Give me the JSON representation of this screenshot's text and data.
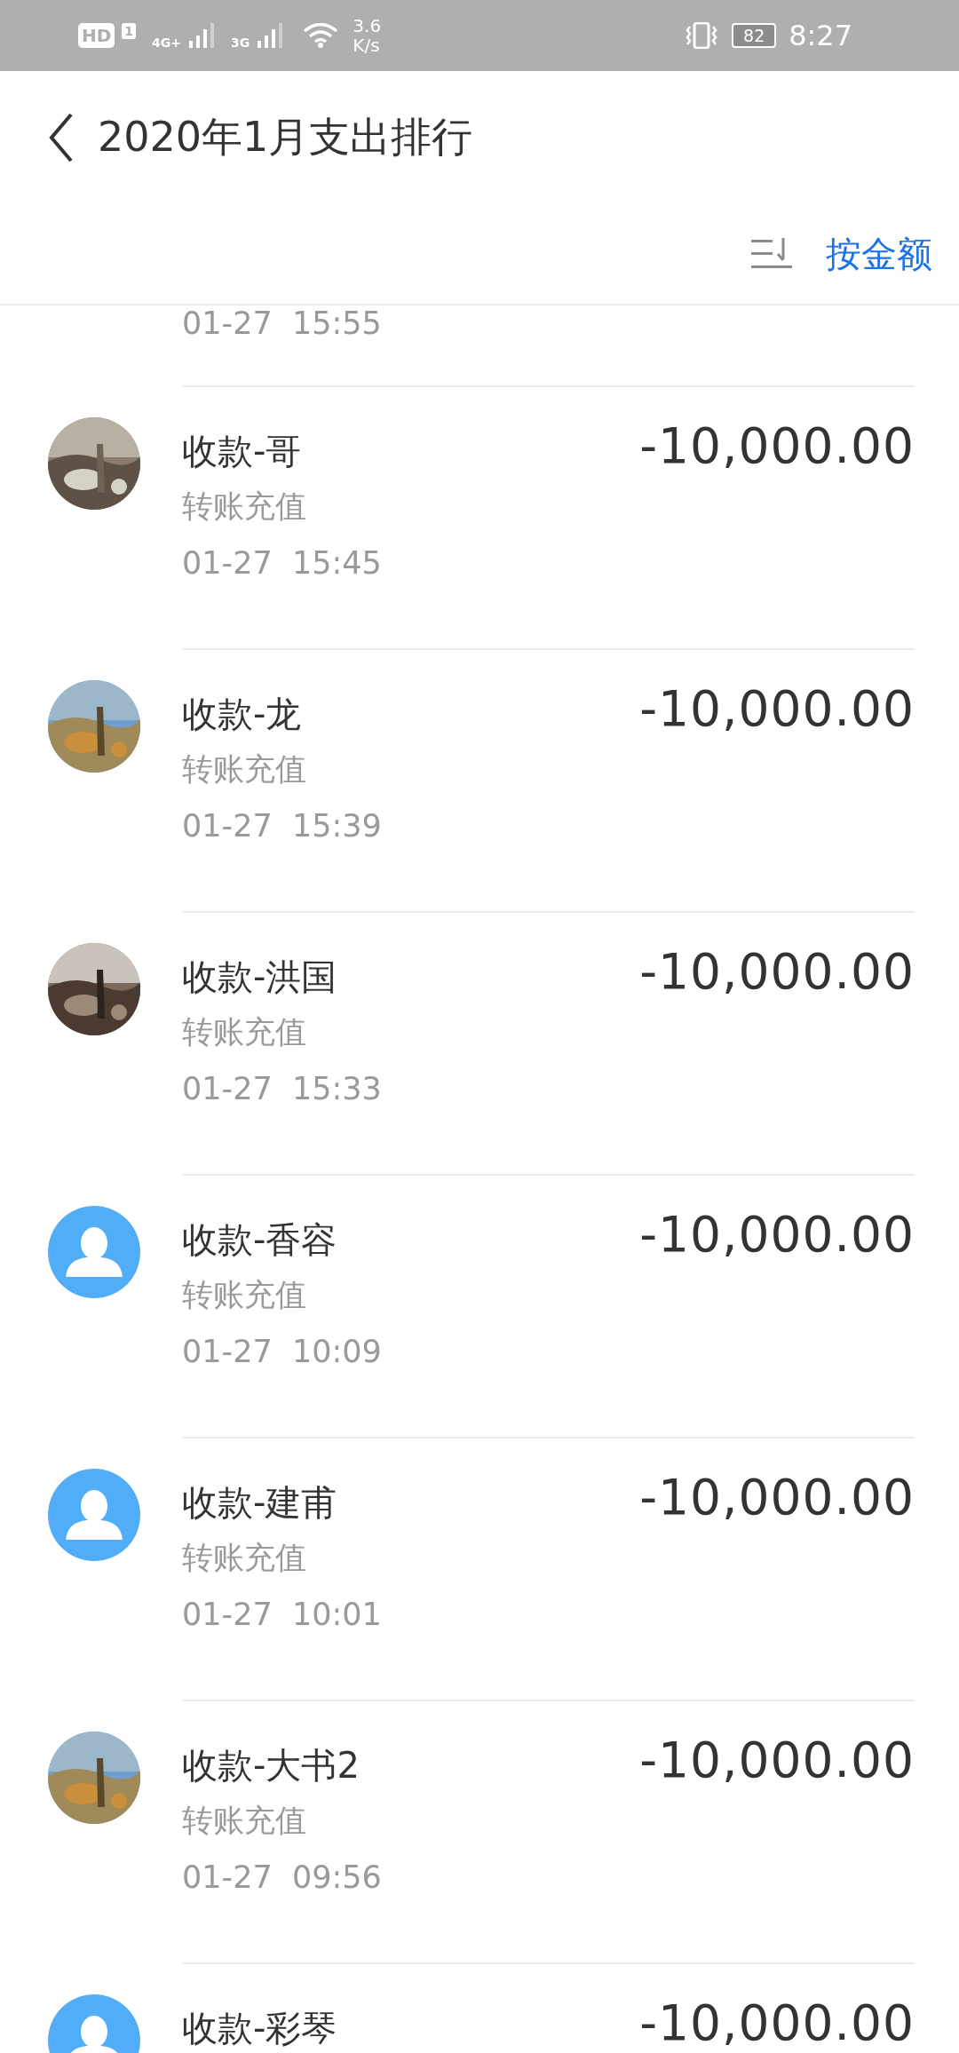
{
  "status_bar": {
    "hd": "HD",
    "sim": "1",
    "network_1": "4G+",
    "network_2": "3G",
    "speed_value": "3.6",
    "speed_unit": "K/s",
    "battery": "82",
    "time": "8:27"
  },
  "header": {
    "title": "2020年1月支出排行"
  },
  "sort": {
    "label": "按金额"
  },
  "partial_row": {
    "time": "01-27  15:55"
  },
  "rows": [
    {
      "kind": "picture",
      "name": "收款-哥",
      "category": "转账充值",
      "time": "01-27  15:45",
      "amount": "-10,000.00"
    },
    {
      "kind": "picture",
      "name": "收款-龙",
      "category": "转账充值",
      "time": "01-27  15:39",
      "amount": "-10,000.00"
    },
    {
      "kind": "picture",
      "name": "收款-洪国",
      "category": "转账充值",
      "time": "01-27  15:33",
      "amount": "-10,000.00"
    },
    {
      "kind": "default_avatar",
      "name": "收款-香容",
      "category": "转账充值",
      "time": "01-27  10:09",
      "amount": "-10,000.00"
    },
    {
      "kind": "default_avatar",
      "name": "收款-建甫",
      "category": "转账充值",
      "time": "01-27  10:01",
      "amount": "-10,000.00"
    },
    {
      "kind": "picture",
      "name": "收款-大书2",
      "category": "转账充值",
      "time": "01-27  09:56",
      "amount": "-10,000.00"
    },
    {
      "kind": "default_avatar",
      "name": "收款-彩琴",
      "amount": "-10,000.00"
    }
  ]
}
